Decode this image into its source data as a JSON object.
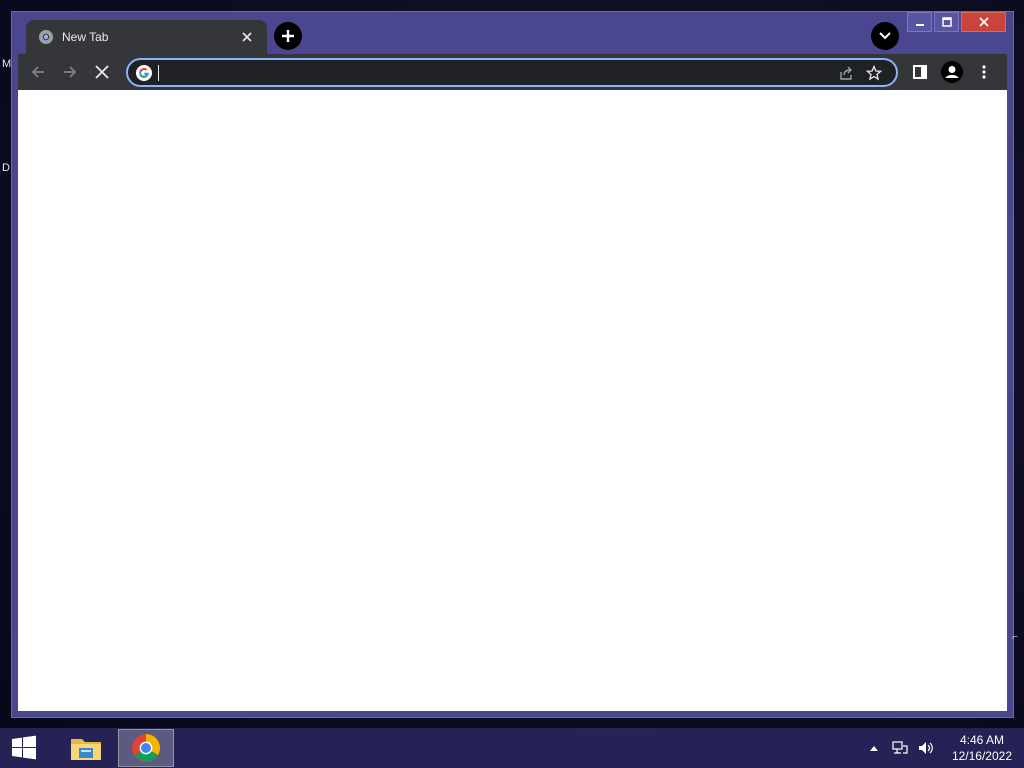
{
  "desktop": {
    "left_glyph_1": "M",
    "left_glyph_2": "D"
  },
  "browser": {
    "tab": {
      "title": "New Tab"
    },
    "omnibox": {
      "value": "",
      "placeholder": ""
    },
    "colors": {
      "frame": "#4a468f",
      "toolbar": "#35363a",
      "omnibox_bg": "#202124",
      "focus_ring": "#8ab4f8",
      "page_bg": "#ffffff",
      "close_button": "#c9453b"
    }
  },
  "taskbar": {
    "clock": {
      "time": "4:46 AM",
      "date": "12/16/2022"
    },
    "apps": [
      {
        "name": "File Explorer",
        "icon": "folder-icon",
        "active": false
      },
      {
        "name": "Google Chrome",
        "icon": "chrome-icon",
        "active": true
      }
    ]
  }
}
